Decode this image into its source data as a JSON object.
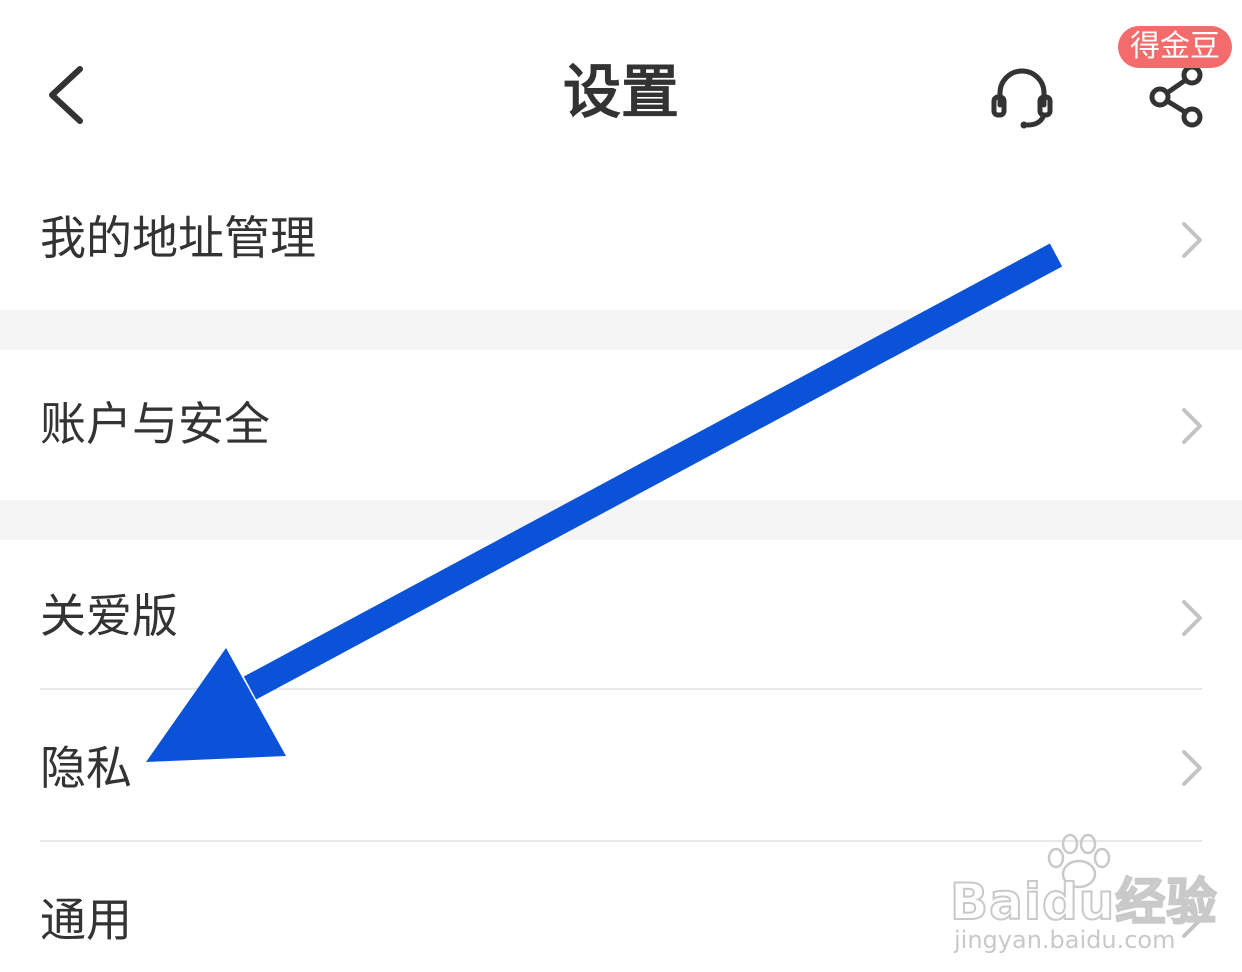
{
  "header": {
    "title": "设置",
    "back_icon": "chevron-left-icon",
    "service_icon": "headset-icon",
    "share_icon": "share-icon",
    "reward_badge": "得金豆",
    "badge_color": "#f46b6b"
  },
  "settings": {
    "address": "我的地址管理",
    "account_security": "账户与安全",
    "care_mode": "关爱版",
    "privacy": "隐私",
    "general": "通用"
  },
  "annotation": {
    "arrow_color": "#0a52d8",
    "arrow_target": "隐私"
  },
  "watermark": {
    "brand": "Baidu经验",
    "url": "jingyan.baidu.com"
  }
}
